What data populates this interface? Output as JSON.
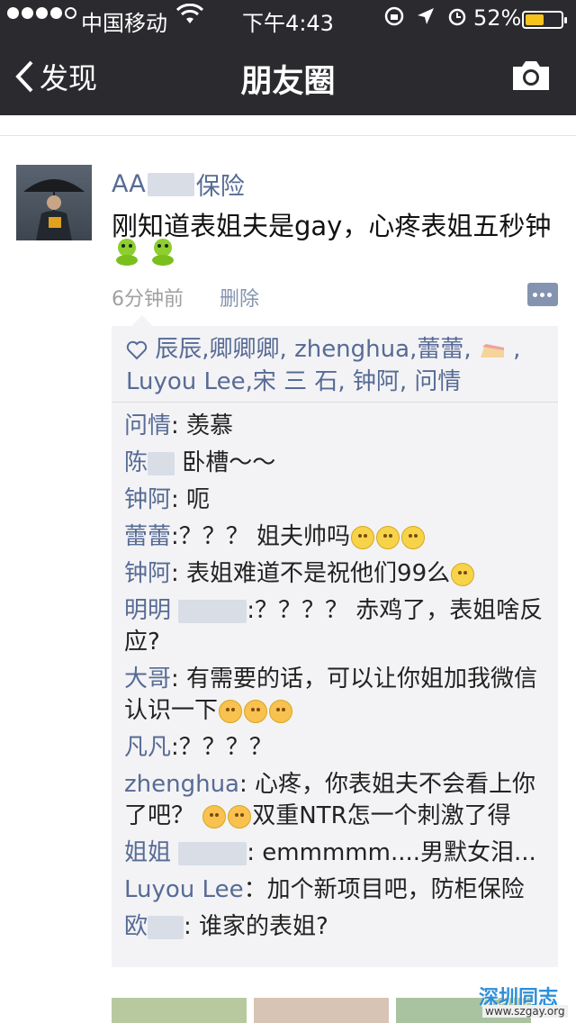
{
  "status_bar": {
    "carrier": "中国移动",
    "time": "下午4:43",
    "battery": "52%",
    "battery_level": 0.52
  },
  "nav": {
    "back_label": "发现",
    "title": "朋友圈"
  },
  "post": {
    "author_prefix": "AA",
    "author_suffix": "保险",
    "content": "刚知道表姐夫是gay，心疼表姐五秒钟",
    "time_ago": "6分钟前",
    "delete_label": "删除"
  },
  "likes": {
    "line1": "辰辰,卿卿卿,",
    "line1b": "zhenghua",
    "line1c": ",蕾蕾,",
    "line2": "Luyou Lee,宋 三 石, 钟阿, 问情"
  },
  "comments": [
    {
      "name": "问情",
      "text": ": 羡慕"
    },
    {
      "name": "陈",
      "text": " 卧槽～～"
    },
    {
      "name": "钟阿",
      "text": ": 呃"
    },
    {
      "name": "蕾蕾",
      "text": ":？？？ 姐夫帅吗"
    },
    {
      "name": "钟阿",
      "text": ": 表姐难道不是祝他们99么"
    },
    {
      "name": "明明",
      "text": ":？？？？ 赤鸡了，表姐啥反应?"
    },
    {
      "name": "大哥",
      "text": ": 有需要的话，可以让你姐加我微信认识一下"
    },
    {
      "name": "凡凡",
      "text": ":？？？？"
    },
    {
      "name": "zhenghua",
      "text": ": 心疼，你表姐夫不会看上你了吧？"
    },
    {
      "name": "",
      "text": "双重NTR怎一个刺激了得"
    },
    {
      "name": "姐姐",
      "text": ": emmmmm....男默女泪..."
    },
    {
      "name": "Luyou Lee",
      "text": "：加个新项目吧，防柜保险"
    },
    {
      "name": "欧",
      "text": ": 谁家的表姐?"
    }
  ],
  "watermark": {
    "title": "深圳同志",
    "url": "www.szgay.org"
  }
}
